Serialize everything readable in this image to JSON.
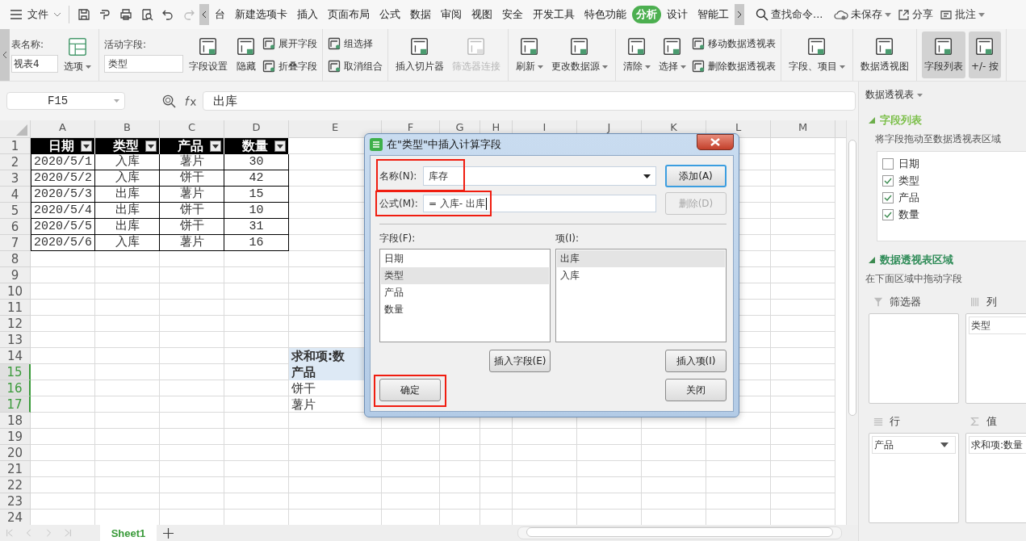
{
  "title_bar": {
    "menu": "文件",
    "tabs": [
      {
        "label": "台",
        "selected": false
      },
      {
        "label": "新建选项卡",
        "selected": false
      },
      {
        "label": "插入",
        "selected": false
      },
      {
        "label": "页面布局",
        "selected": false
      },
      {
        "label": "公式",
        "selected": false
      },
      {
        "label": "数据",
        "selected": false
      },
      {
        "label": "审阅",
        "selected": false
      },
      {
        "label": "视图",
        "selected": false
      },
      {
        "label": "安全",
        "selected": false
      },
      {
        "label": "开发工具",
        "selected": false
      },
      {
        "label": "特色功能",
        "selected": false
      },
      {
        "label": "分析",
        "selected": true
      },
      {
        "label": "设计",
        "selected": false
      },
      {
        "label": "智能工",
        "selected": false
      }
    ],
    "search": "查找命令...",
    "unsaved": "未保存",
    "share": "分享",
    "comment": "批注"
  },
  "ribbon": {
    "name_label": "表名称:",
    "name_value": "视表4",
    "options": "选项",
    "field_label": "活动字段:",
    "field_value": "类型",
    "groups": [
      {
        "items": [
          {
            "label": "字段设置",
            "kind": "large",
            "caret": false,
            "disabled": false,
            "selected": false
          },
          {
            "label": "隐藏",
            "kind": "large",
            "caret": false,
            "disabled": false,
            "selected": false
          },
          {
            "label": "展开字段",
            "kind": "small",
            "caret": false,
            "disabled": false,
            "selected": false
          },
          {
            "label": "折叠字段",
            "kind": "small",
            "caret": false,
            "disabled": false,
            "selected": false
          }
        ]
      },
      {
        "items": [
          {
            "label": "组选择",
            "kind": "small",
            "caret": false,
            "disabled": false,
            "selected": false
          },
          {
            "label": "取消组合",
            "kind": "small",
            "caret": false,
            "disabled": false,
            "selected": false
          }
        ]
      },
      {
        "items": [
          {
            "label": "插入切片器",
            "kind": "large",
            "caret": false,
            "disabled": false,
            "selected": false
          },
          {
            "label": "筛选器连接",
            "kind": "large",
            "caret": false,
            "disabled": true,
            "selected": false
          }
        ]
      },
      {
        "items": [
          {
            "label": "刷新",
            "kind": "large",
            "caret": true,
            "disabled": false,
            "selected": false
          },
          {
            "label": "更改数据源",
            "kind": "large",
            "caret": true,
            "disabled": false,
            "selected": false
          }
        ]
      },
      {
        "items": [
          {
            "label": "清除",
            "kind": "large",
            "caret": true,
            "disabled": false,
            "selected": false
          },
          {
            "label": "选择",
            "kind": "large",
            "caret": true,
            "disabled": false,
            "selected": false
          },
          {
            "label": "移动数据透视表",
            "kind": "small",
            "caret": false,
            "disabled": false,
            "selected": false
          },
          {
            "label": "删除数据透视表",
            "kind": "small",
            "caret": false,
            "disabled": false,
            "selected": false
          }
        ]
      },
      {
        "items": [
          {
            "label": "字段、项目",
            "kind": "large",
            "caret": true,
            "disabled": false,
            "selected": false
          }
        ]
      },
      {
        "items": [
          {
            "label": "数据透视图",
            "kind": "large",
            "caret": false,
            "disabled": false,
            "selected": false
          }
        ]
      },
      {
        "items": [
          {
            "label": "字段列表",
            "kind": "large",
            "caret": false,
            "disabled": false,
            "selected": true
          },
          {
            "label": "+/- 按",
            "kind": "large",
            "caret": false,
            "disabled": false,
            "selected": true
          }
        ]
      }
    ]
  },
  "formula_bar": {
    "cell": "F15",
    "value": "出库"
  },
  "sheet": {
    "columns": [
      "A",
      "B",
      "C",
      "D",
      "E",
      "F",
      "G",
      "H",
      "I",
      "J",
      "K",
      "L",
      "M"
    ],
    "rows": [
      {
        "label": "1",
        "selected": false
      },
      {
        "label": "2",
        "selected": false
      },
      {
        "label": "3",
        "selected": false
      },
      {
        "label": "4",
        "selected": false
      },
      {
        "label": "5",
        "selected": false
      },
      {
        "label": "6",
        "selected": false
      },
      {
        "label": "7",
        "selected": false
      },
      {
        "label": "8",
        "selected": false
      },
      {
        "label": "9",
        "selected": false
      },
      {
        "label": "10",
        "selected": false
      },
      {
        "label": "11",
        "selected": false
      },
      {
        "label": "12",
        "selected": false
      },
      {
        "label": "13",
        "selected": false
      },
      {
        "label": "14",
        "selected": false
      },
      {
        "label": "15",
        "selected": true
      },
      {
        "label": "16",
        "selected": true
      },
      {
        "label": "17",
        "selected": true
      },
      {
        "label": "18",
        "selected": false
      },
      {
        "label": "19",
        "selected": false
      },
      {
        "label": "20",
        "selected": false
      },
      {
        "label": "21",
        "selected": false
      },
      {
        "label": "22",
        "selected": false
      },
      {
        "label": "23",
        "selected": false
      },
      {
        "label": "24",
        "selected": false
      }
    ],
    "table": {
      "headers": [
        "日期",
        "类型",
        "产品",
        "数量"
      ],
      "rows": [
        [
          "2020/5/1",
          "入库",
          "薯片",
          "30"
        ],
        [
          "2020/5/2",
          "入库",
          "饼干",
          "42"
        ],
        [
          "2020/5/3",
          "出库",
          "薯片",
          "15"
        ],
        [
          "2020/5/4",
          "出库",
          "饼干",
          "10"
        ],
        [
          "2020/5/5",
          "出库",
          "饼干",
          "31"
        ],
        [
          "2020/5/6",
          "入库",
          "薯片",
          "16"
        ]
      ]
    },
    "pivot": {
      "title": "求和项:数",
      "row_label": "产品",
      "items": [
        "饼干",
        "薯片"
      ]
    }
  },
  "sheet_tabs": [
    {
      "label": "Sheet1",
      "selected": true
    }
  ],
  "dialog": {
    "title": "在\"类型\"中插入计算字段",
    "name": {
      "label": "名称(N):",
      "value": "库存",
      "highlighted": true
    },
    "formula": {
      "label": "公式(M):",
      "value": "= 入库- 出库",
      "highlighted": true
    },
    "add_button": {
      "label": "添加(A)",
      "disabled": false
    },
    "delete_button": {
      "label": "删除(D)",
      "disabled": true
    },
    "fields_label": "字段(F):",
    "fields": [
      {
        "label": "日期",
        "selected": false
      },
      {
        "label": "类型",
        "selected": true
      },
      {
        "label": "产品",
        "selected": false
      },
      {
        "label": "数量",
        "selected": false
      }
    ],
    "items_label": "项(I):",
    "items": [
      {
        "label": "出库",
        "selected": true
      },
      {
        "label": "入库",
        "selected": false
      }
    ],
    "insert_field": "插入字段(E)",
    "insert_item": "插入项(I)",
    "ok": {
      "label": "确定",
      "highlighted": true
    },
    "close": "关闭"
  },
  "panel": {
    "title": "数据透视表",
    "field_section": "字段列表",
    "field_hint": "将字段拖动至数据透视表区域",
    "fields": [
      {
        "label": "日期",
        "checked": false
      },
      {
        "label": "类型",
        "checked": true
      },
      {
        "label": "产品",
        "checked": true
      },
      {
        "label": "数量",
        "checked": true
      }
    ],
    "area_section": "数据透视表区域",
    "area_hint": "在下面区域中拖动字段",
    "areas": [
      {
        "kind": "filter",
        "label": "筛选器"
      },
      {
        "kind": "columns",
        "label": "列",
        "items": [
          "类型"
        ]
      },
      {
        "kind": "rows",
        "label": "行",
        "items": [
          "产品"
        ]
      },
      {
        "kind": "values",
        "label": "值",
        "items": [
          "求和项:数量"
        ]
      }
    ]
  }
}
